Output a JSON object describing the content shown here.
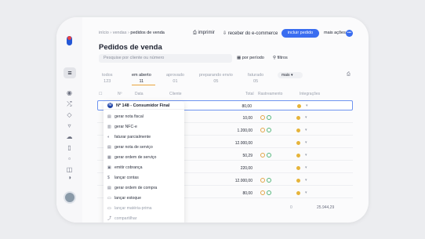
{
  "breadcrumb": {
    "start": "início",
    "sep1": "›",
    "section": "vendas",
    "sep2": "›",
    "current": "pedidos de venda"
  },
  "toolbar": {
    "print": "imprimir",
    "receive": "receber do e-commerce",
    "add": "incluir pedido",
    "more": "mais ações"
  },
  "page_title": "Pedidos de venda",
  "search": {
    "placeholder": "Pesquise por cliente ou número"
  },
  "filters": {
    "period": "por período",
    "filters": "filtros"
  },
  "tabs": [
    {
      "label": "todos",
      "count": "123"
    },
    {
      "label": "em aberto",
      "count": "11"
    },
    {
      "label": "aprovado",
      "count": "01"
    },
    {
      "label": "preparando envio",
      "count": "05"
    },
    {
      "label": "faturado",
      "count": "05"
    }
  ],
  "more_tabs": "mais",
  "columns": {
    "number": "Nº",
    "date": "Data",
    "client": "Cliente",
    "total": "Total",
    "tracking": "Rastreamento",
    "integrations": "Integrações"
  },
  "rows": [
    {
      "total": "80,00"
    },
    {
      "total": "10,00"
    },
    {
      "total": "1.200,00"
    },
    {
      "total": "12.000,00"
    },
    {
      "total": "50,29"
    },
    {
      "total": "220,00"
    },
    {
      "total": "12.000,00"
    },
    {
      "total": "80,00"
    }
  ],
  "dropdown": {
    "badge": "M",
    "title": "Nº 148 - Consumidor Final",
    "items": [
      {
        "icon": "document-icon",
        "glyph": "▤",
        "label": "gerar nota fiscal"
      },
      {
        "icon": "receipt-icon",
        "glyph": "▥",
        "label": "gerar NFC-e"
      },
      {
        "icon": "partial-icon",
        "glyph": "◐",
        "label": "faturar parcialmente"
      },
      {
        "icon": "service-invoice-icon",
        "glyph": "▤",
        "label": "gerar nota de serviço"
      },
      {
        "icon": "service-order-icon",
        "glyph": "▦",
        "label": "gerar ordem de serviço"
      },
      {
        "icon": "billing-icon",
        "glyph": "▣",
        "label": "emitir cobrança"
      },
      {
        "icon": "dollar-icon",
        "glyph": "$",
        "label": "lançar contas"
      },
      {
        "icon": "purchase-order-icon",
        "glyph": "▤",
        "label": "gerar ordem de compra"
      },
      {
        "icon": "stock-icon",
        "glyph": "▭",
        "label": "lançar estoque"
      },
      {
        "icon": "raw-material-icon",
        "glyph": "▭",
        "label": "lançar matéria-prima"
      }
    ],
    "last_item": "compartilhar"
  },
  "footer": {
    "count": "0",
    "total": "25.944,29"
  }
}
